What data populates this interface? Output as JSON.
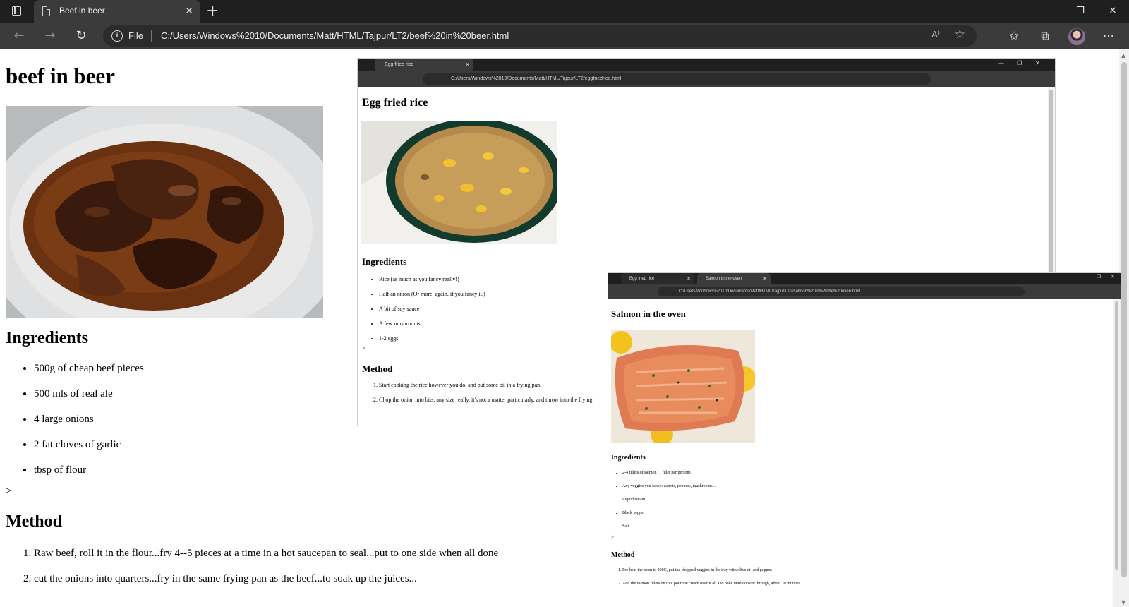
{
  "browser": {
    "tab_title": "Beef in beer",
    "tab_close": "✕",
    "new_tab": "+",
    "address_file_label": "File",
    "address_url": "C:/Users/Windows%2010/Documents/Matt/HTML/Tajpur/LT2/beef%20in%20beer.html",
    "read_aloud": "A⁾",
    "window_controls": [
      "—",
      "❐",
      "✕"
    ],
    "icons": [
      "tab-actions-icon",
      "page-icon",
      "close-icon",
      "add-tab-icon",
      "back-icon",
      "forward-icon",
      "refresh-icon",
      "info-icon",
      "read-aloud-icon",
      "add-favorite-icon",
      "favorites-icon",
      "collections-icon",
      "profile-avatar",
      "more-icon",
      "minimize-icon",
      "restore-icon"
    ]
  },
  "page": {
    "title": "beef in beer",
    "ingredients_heading": "Ingredients",
    "ingredients": [
      "500g of cheap beef pieces",
      "500 mls of real ale",
      "4 large onions",
      "2 fat cloves of garlic",
      "tbsp of flour"
    ],
    "stray_text": ">",
    "method_heading": "Method",
    "method": [
      "Raw beef, roll it in the flour...fry 4--5 pieces at a time in a hot saucepan to seal...put to one side when all done",
      "cut the onions into quarters...fry in the same frying pan as the beef...to soak up the juices..."
    ]
  },
  "egg_window": {
    "tab_title": "Egg fried rice",
    "address_url": "C:/Users/Windows%2010/Documents/Matt/HTML/Tajpur/LT2/eggfriedrice.html",
    "title": "Egg fried rice",
    "ingredients_heading": "Ingredients",
    "ingredients": [
      "Rice (as much as you fancy really!)",
      "Half an onion (Or more, again, if you fancy it.)",
      "A bit of soy sauce",
      "A few mushrooms",
      "1-2 eggs"
    ],
    "stray_text": ">",
    "method_heading": "Method",
    "method": [
      "Start cooking the rice however you do, and put some oil in a frying pan.",
      "Chop the onion into bits, any size really, it's not a matter particularly, and throw into the frying"
    ]
  },
  "salmon_window": {
    "tabs": [
      "Egg fried rice",
      "Salmon in the oven"
    ],
    "address_url": "C:/Users/Windows%2010/Documents/Matt/HTML/Tajpur/LT2/salmon%20in%20the%20oven.html",
    "title": "Salmon in the oven",
    "ingredients_heading": "Ingredients",
    "ingredients": [
      "2-4 fillets of salmon (1 fillet per person)",
      "Any veggies you fancy: carrots, peppers, mushrooms...",
      "Liquid cream",
      "Black pepper",
      "Salt"
    ],
    "stray_text": ">",
    "method_heading": "Method",
    "method": [
      "Pre-heat the oven to 200C, put the chopped veggies in the tray with olive oil and pepper.",
      "Add the salmon fillets on top, pour the cream over it all and bake until cooked through, about 20 minutes."
    ]
  }
}
